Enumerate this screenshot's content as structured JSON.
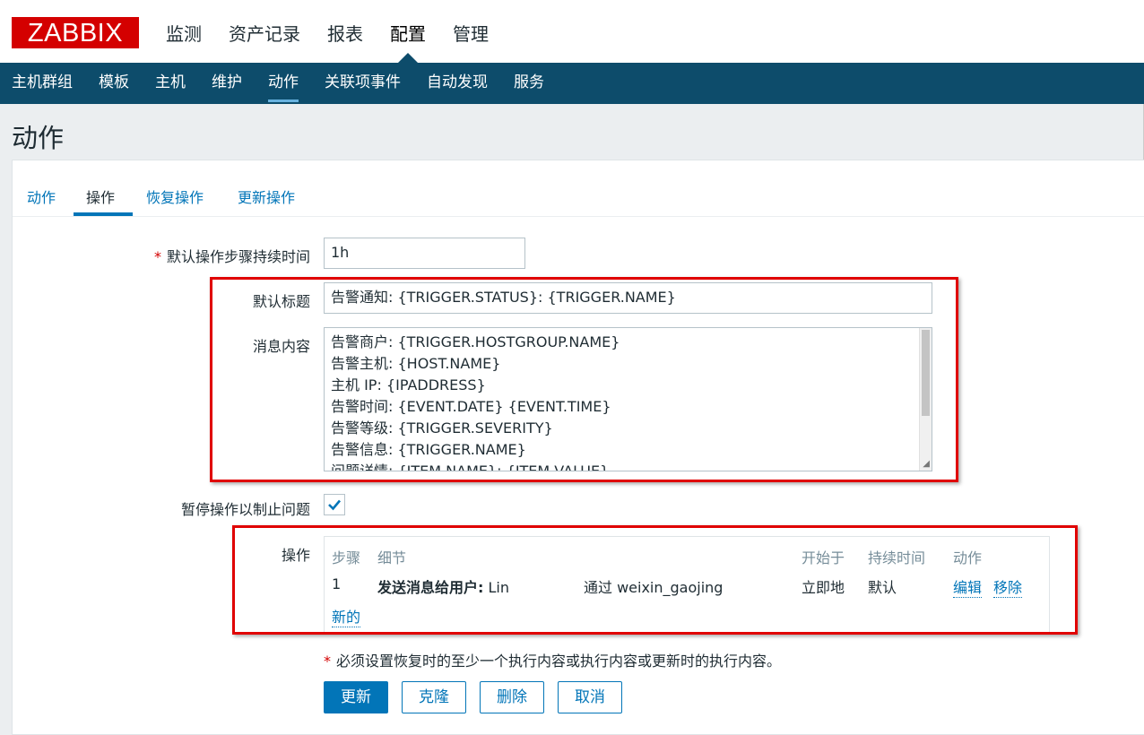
{
  "header": {
    "logo": "ZABBIX",
    "nav": [
      "监测",
      "资产记录",
      "报表",
      "配置",
      "管理"
    ],
    "active_nav": "配置"
  },
  "subnav": {
    "items": [
      "主机群组",
      "模板",
      "主机",
      "维护",
      "动作",
      "关联项事件",
      "自动发现",
      "服务"
    ],
    "active": "动作"
  },
  "page_title": "动作",
  "tabs": [
    "动作",
    "操作",
    "恢复操作",
    "更新操作"
  ],
  "form": {
    "step_duration_label": "默认操作步骤持续时间",
    "step_duration_value": "1h",
    "subject_label": "默认标题",
    "subject_value": "告警通知: {TRIGGER.STATUS}: {TRIGGER.NAME}",
    "message_label": "消息内容",
    "message_lines": [
      "告警商户: {TRIGGER.HOSTGROUP.NAME}",
      "告警主机: {HOST.NAME}",
      "主机 IP: {IPADDRESS}",
      "告警时间: {EVENT.DATE} {EVENT.TIME}",
      "告警等级: {TRIGGER.SEVERITY}",
      "告警信息: {TRIGGER.NAME}",
      "问题详情: {ITEM.NAME}: {ITEM.VALUE}"
    ],
    "pause_label": "暂停操作以制止问题",
    "pause_checked": true,
    "operations_label": "操作"
  },
  "operations": {
    "headers": [
      "步骤",
      "细节",
      "开始于",
      "持续时间",
      "动作"
    ],
    "rows": [
      {
        "step": "1",
        "detail_bold": "发送消息给用户:",
        "detail_user": "Lin",
        "detail_via": "通过 weixin_gaojing",
        "start": "立即地",
        "duration": "默认",
        "edit": "编辑",
        "remove": "移除"
      }
    ],
    "new_link": "新的"
  },
  "footnote": "必须设置恢复时的至少一个执行内容或执行内容或更新时的执行内容。",
  "footnote_star": "*",
  "buttons": {
    "update": "更新",
    "clone": "克隆",
    "delete": "删除",
    "cancel": "取消"
  },
  "colors": {
    "logo_red": "#d40000",
    "subnav_bg": "#0d4c6b",
    "link_blue": "#0275b8",
    "annotation_red": "#e00000"
  }
}
